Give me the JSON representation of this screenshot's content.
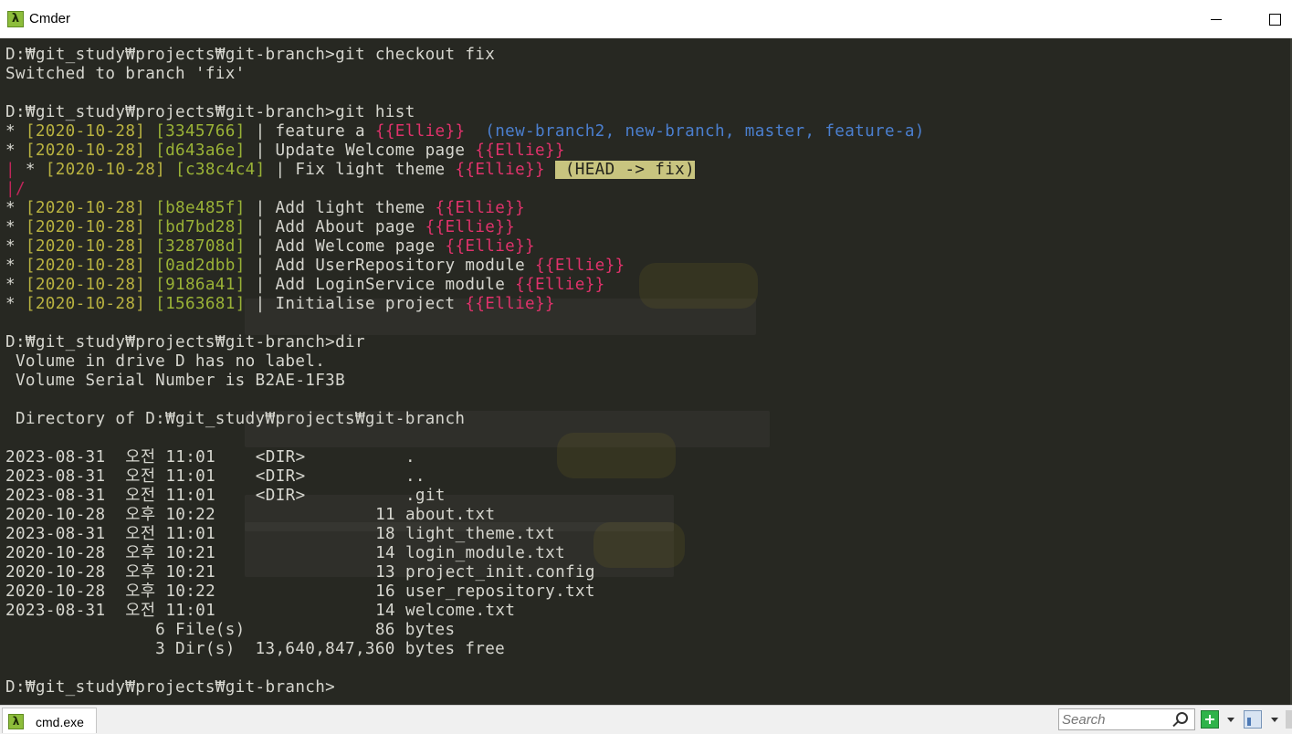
{
  "window": {
    "title": "Cmder"
  },
  "colors": {
    "terminal_bg": "#272822",
    "date": "#b9b240",
    "hash": "#9ab236",
    "author": "#e0326b",
    "refs": "#4b7fcf",
    "head_badge_bg": "#c8c47f"
  },
  "terminal": {
    "prompt": "D:₩git_study₩projects₩git-branch>",
    "lines": [
      [
        {
          "t": "D:₩git_study₩projects₩git-branch>git checkout fix",
          "c": ""
        }
      ],
      [
        {
          "t": "Switched to branch 'fix'",
          "c": ""
        }
      ],
      [],
      [
        {
          "t": "D:₩git_study₩projects₩git-branch>git hist",
          "c": ""
        }
      ],
      [
        {
          "t": "* ",
          "c": ""
        },
        {
          "t": "[2020-10-28]",
          "c": "c-date"
        },
        {
          "t": " ",
          "c": ""
        },
        {
          "t": "[3345766]",
          "c": "c-hash"
        },
        {
          "t": " | feature a ",
          "c": ""
        },
        {
          "t": "{{Ellie}}",
          "c": "c-author"
        },
        {
          "t": "  (new-branch2, new-branch, master, feature-a)",
          "c": "c-ref"
        }
      ],
      [
        {
          "t": "* ",
          "c": ""
        },
        {
          "t": "[2020-10-28]",
          "c": "c-date"
        },
        {
          "t": " ",
          "c": ""
        },
        {
          "t": "[d643a6e]",
          "c": "c-hash"
        },
        {
          "t": " | Update Welcome page ",
          "c": ""
        },
        {
          "t": "{{Ellie}}",
          "c": "c-author"
        }
      ],
      [
        {
          "t": "|",
          "c": "c-graph"
        },
        {
          "t": " * ",
          "c": ""
        },
        {
          "t": "[2020-10-28]",
          "c": "c-date"
        },
        {
          "t": " ",
          "c": ""
        },
        {
          "t": "[c38c4c4]",
          "c": "c-hash"
        },
        {
          "t": " | Fix light theme ",
          "c": ""
        },
        {
          "t": "{{Ellie}}",
          "c": "c-author"
        },
        {
          "t": " ",
          "c": ""
        },
        {
          "t": " (HEAD -> fix)",
          "c": "c-head"
        }
      ],
      [
        {
          "t": "|/",
          "c": "c-graph"
        }
      ],
      [
        {
          "t": "* ",
          "c": ""
        },
        {
          "t": "[2020-10-28]",
          "c": "c-date"
        },
        {
          "t": " ",
          "c": ""
        },
        {
          "t": "[b8e485f]",
          "c": "c-hash"
        },
        {
          "t": " | Add light theme ",
          "c": ""
        },
        {
          "t": "{{Ellie}}",
          "c": "c-author"
        }
      ],
      [
        {
          "t": "* ",
          "c": ""
        },
        {
          "t": "[2020-10-28]",
          "c": "c-date"
        },
        {
          "t": " ",
          "c": ""
        },
        {
          "t": "[bd7bd28]",
          "c": "c-hash"
        },
        {
          "t": " | Add About page ",
          "c": ""
        },
        {
          "t": "{{Ellie}}",
          "c": "c-author"
        }
      ],
      [
        {
          "t": "* ",
          "c": ""
        },
        {
          "t": "[2020-10-28]",
          "c": "c-date"
        },
        {
          "t": " ",
          "c": ""
        },
        {
          "t": "[328708d]",
          "c": "c-hash"
        },
        {
          "t": " | Add Welcome page ",
          "c": ""
        },
        {
          "t": "{{Ellie}}",
          "c": "c-author"
        }
      ],
      [
        {
          "t": "* ",
          "c": ""
        },
        {
          "t": "[2020-10-28]",
          "c": "c-date"
        },
        {
          "t": " ",
          "c": ""
        },
        {
          "t": "[0ad2dbb]",
          "c": "c-hash"
        },
        {
          "t": " | Add UserRepository module ",
          "c": ""
        },
        {
          "t": "{{Ellie}}",
          "c": "c-author"
        }
      ],
      [
        {
          "t": "* ",
          "c": ""
        },
        {
          "t": "[2020-10-28]",
          "c": "c-date"
        },
        {
          "t": " ",
          "c": ""
        },
        {
          "t": "[9186a41]",
          "c": "c-hash"
        },
        {
          "t": " | Add LoginService module ",
          "c": ""
        },
        {
          "t": "{{Ellie}}",
          "c": "c-author"
        }
      ],
      [
        {
          "t": "* ",
          "c": ""
        },
        {
          "t": "[2020-10-28]",
          "c": "c-date"
        },
        {
          "t": " ",
          "c": ""
        },
        {
          "t": "[1563681]",
          "c": "c-hash"
        },
        {
          "t": " | Initialise project ",
          "c": ""
        },
        {
          "t": "{{Ellie}}",
          "c": "c-author"
        }
      ],
      [],
      [
        {
          "t": "D:₩git_study₩projects₩git-branch>dir",
          "c": ""
        }
      ],
      [
        {
          "t": " Volume in drive D has no label.",
          "c": ""
        }
      ],
      [
        {
          "t": " Volume Serial Number is B2AE-1F3B",
          "c": ""
        }
      ],
      [],
      [
        {
          "t": " Directory of D:₩git_study₩projects₩git-branch",
          "c": ""
        }
      ],
      [],
      [
        {
          "t": "2023-08-31  오전 11:01    <DIR>          .",
          "c": ""
        }
      ],
      [
        {
          "t": "2023-08-31  오전 11:01    <DIR>          ..",
          "c": ""
        }
      ],
      [
        {
          "t": "2023-08-31  오전 11:01    <DIR>          .git",
          "c": ""
        }
      ],
      [
        {
          "t": "2020-10-28  오후 10:22                11 about.txt",
          "c": ""
        }
      ],
      [
        {
          "t": "2023-08-31  오전 11:01                18 light_theme.txt",
          "c": ""
        }
      ],
      [
        {
          "t": "2020-10-28  오후 10:21                14 login_module.txt",
          "c": ""
        }
      ],
      [
        {
          "t": "2020-10-28  오후 10:21                13 project_init.config",
          "c": ""
        }
      ],
      [
        {
          "t": "2020-10-28  오후 10:22                16 user_repository.txt",
          "c": ""
        }
      ],
      [
        {
          "t": "2023-08-31  오전 11:01                14 welcome.txt",
          "c": ""
        }
      ],
      [
        {
          "t": "               6 File(s)             86 bytes",
          "c": ""
        }
      ],
      [
        {
          "t": "               3 Dir(s)  13,640,847,360 bytes free",
          "c": ""
        }
      ],
      [],
      [
        {
          "t": "D:₩git_study₩projects₩git-branch>",
          "c": ""
        }
      ]
    ]
  },
  "statusbar": {
    "tab_label": "cmd.exe",
    "search_placeholder": "Search",
    "icons": {
      "app": "lambda-icon",
      "search": "search-icon",
      "new_console": "plus-icon",
      "split": "split-view-icon"
    }
  }
}
